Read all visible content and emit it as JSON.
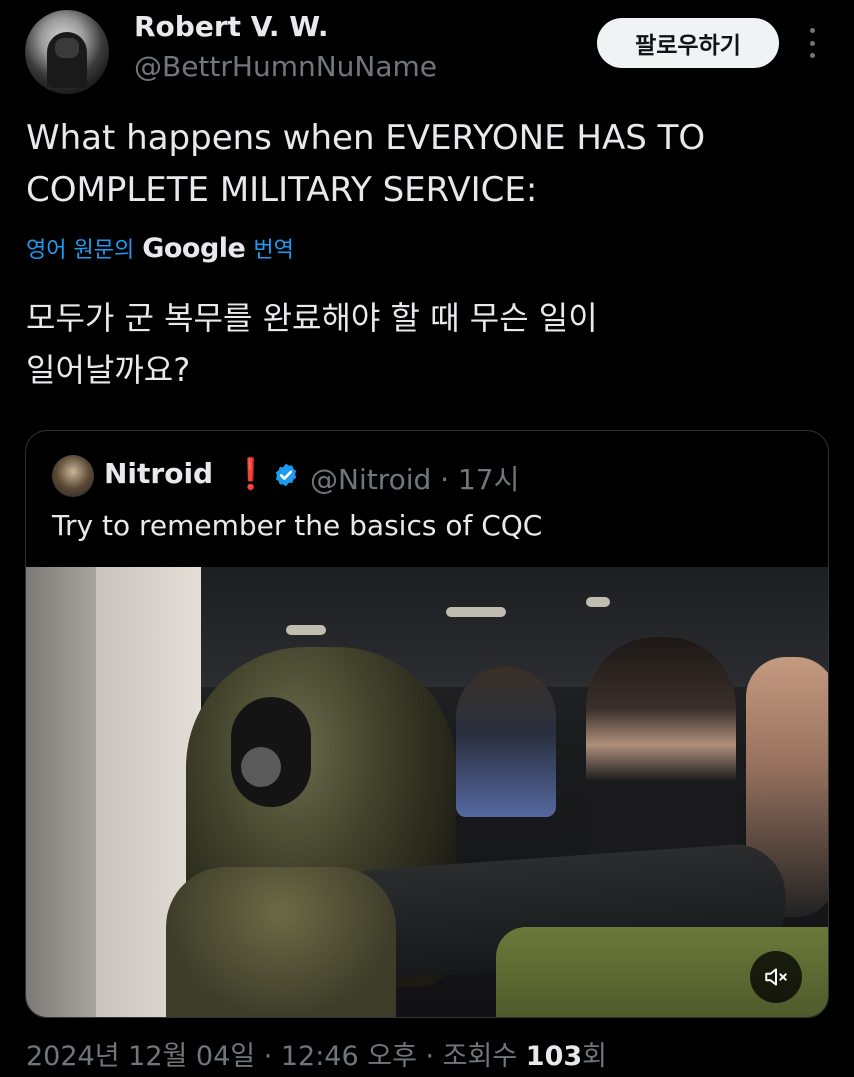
{
  "author": {
    "name": "Robert V. W.",
    "handle": "@BettrHumnNuName",
    "follow_label": "팔로우하기"
  },
  "tweet": {
    "text_line1": "What happens when EVERYONE HAS TO",
    "text_line2": "COMPLETE MILITARY SERVICE:",
    "translate_prefix": "영어 원문의",
    "translate_brand": "Google",
    "translate_suffix": "번역",
    "translated_line1": "모두가 군 복무를 완료해야 할 때 무슨 일이",
    "translated_line2": "일어날까요?"
  },
  "quoted": {
    "name": "Nitroid",
    "emoji": "❗",
    "handle_time": "@Nitroid · 17시",
    "text": "Try to remember the basics of CQC"
  },
  "meta": {
    "timestamp": "2024년 12월 04일 · 12:46 오후 · 조회수 ",
    "views": "103",
    "views_suffix": "회"
  },
  "icons": {
    "more": "more-icon",
    "verified": "verified-badge-icon",
    "mute": "mute-icon"
  },
  "colors": {
    "background": "#000000",
    "text": "#e7e9ea",
    "muted": "#71767b",
    "link": "#1d9bf0",
    "verified": "#1d9bf0",
    "follow_bg": "#eff3f4"
  }
}
